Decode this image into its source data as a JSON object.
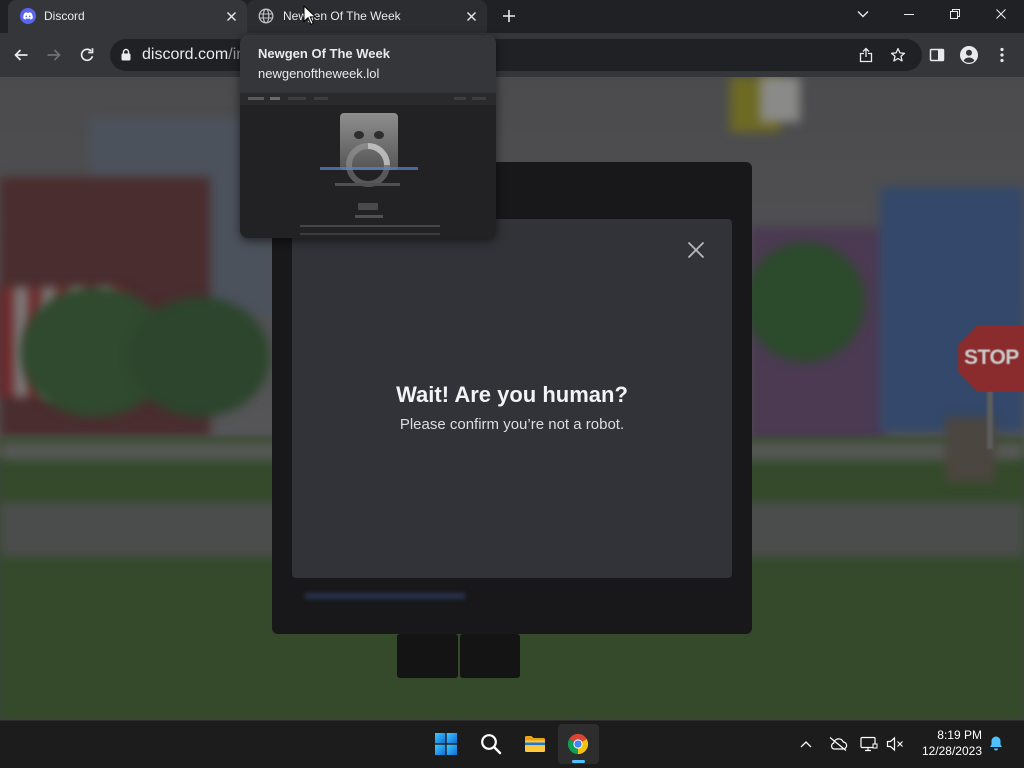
{
  "colors": {
    "tabstrip": "#202124",
    "toolbar": "#35363a",
    "omnibox": "#202124",
    "modal_background": "#313338",
    "discord_blurple": "#5865f2",
    "taskbar": "#1c1c1c",
    "accent_blue": "#4cc2ff"
  },
  "browser": {
    "tabs": [
      {
        "title": "Discord",
        "icon": "discord-icon",
        "active": true,
        "close_icon": "close-icon"
      },
      {
        "title": "Newgen Of The Week",
        "icon": "globe-icon",
        "active": false,
        "hovered": true,
        "close_icon": "close-icon"
      }
    ],
    "new_tab_icon": "plus-icon",
    "window_controls": {
      "tab_search": "chevron-down-icon",
      "minimize": "minimize-icon",
      "restore": "restore-icon",
      "close": "close-icon"
    },
    "nav": {
      "back": "arrow-left-icon",
      "forward": "arrow-right-icon",
      "forward_enabled": false,
      "reload": "reload-icon"
    },
    "omnibox": {
      "security_icon": "lock-icon",
      "host": "discord.com",
      "path": "/inv",
      "actions": [
        "share-icon",
        "star-icon"
      ]
    },
    "toolbar_actions": [
      "side-panel-icon",
      "profile-icon",
      "more-vertical-icon"
    ],
    "hover_card": {
      "title": "Newgen Of The Week",
      "domain": "newgenoftheweek.lol"
    }
  },
  "page": {
    "background_scene": {
      "sign_text": "STOP"
    },
    "captcha_modal": {
      "title": "Wait! Are you human?",
      "subtitle": "Please confirm you’re not a robot.",
      "close_icon": "close-icon"
    }
  },
  "taskbar": {
    "pinned": [
      {
        "icon": "windows-start-icon"
      },
      {
        "icon": "search-icon"
      },
      {
        "icon": "file-explorer-icon"
      },
      {
        "icon": "chrome-icon",
        "running": true,
        "active": true
      }
    ],
    "tray": {
      "overflow_icon": "chevron-up-icon",
      "icons": [
        "cloud-off-icon",
        "network-icon",
        "volume-muted-icon"
      ],
      "time": "8:19 PM",
      "date": "12/28/2023",
      "notifications_icon": "bell-icon"
    }
  }
}
